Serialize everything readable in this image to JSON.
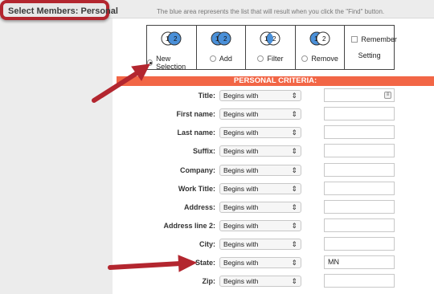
{
  "page": {
    "title": "Select Members: Personal",
    "hint_text": "The blue area represents the list that will result when you click the \"Find\" button."
  },
  "options": {
    "venn_left": "1",
    "venn_right": "2",
    "new_selection": "New Selection",
    "add": "Add",
    "filter": "Filter",
    "remove": "Remove",
    "remember": "Remember",
    "setting": "Setting",
    "selected": "new_selection"
  },
  "criteria": {
    "header": "PERSONAL CRITERIA:",
    "rows": [
      {
        "label": "Title:",
        "operator": "Begins with",
        "value": ""
      },
      {
        "label": "First name:",
        "operator": "Begins with",
        "value": ""
      },
      {
        "label": "Last name:",
        "operator": "Begins with",
        "value": ""
      },
      {
        "label": "Suffix:",
        "operator": "Begins with",
        "value": ""
      },
      {
        "label": "Company:",
        "operator": "Begins with",
        "value": ""
      },
      {
        "label": "Work Title:",
        "operator": "Begins with",
        "value": ""
      },
      {
        "label": "Address:",
        "operator": "Begins with",
        "value": ""
      },
      {
        "label": "Address line 2:",
        "operator": "Begins with",
        "value": ""
      },
      {
        "label": "City:",
        "operator": "Begins with",
        "value": ""
      },
      {
        "label": "State:",
        "operator": "Begins with",
        "value": "MN"
      },
      {
        "label": "Zip:",
        "operator": "Begins with",
        "value": ""
      }
    ]
  },
  "colors": {
    "accent_bar": "#f26646",
    "highlight_border": "#b3262f",
    "annotation_arrow": "#b3262f",
    "venn_blue": "#4a90d9"
  }
}
